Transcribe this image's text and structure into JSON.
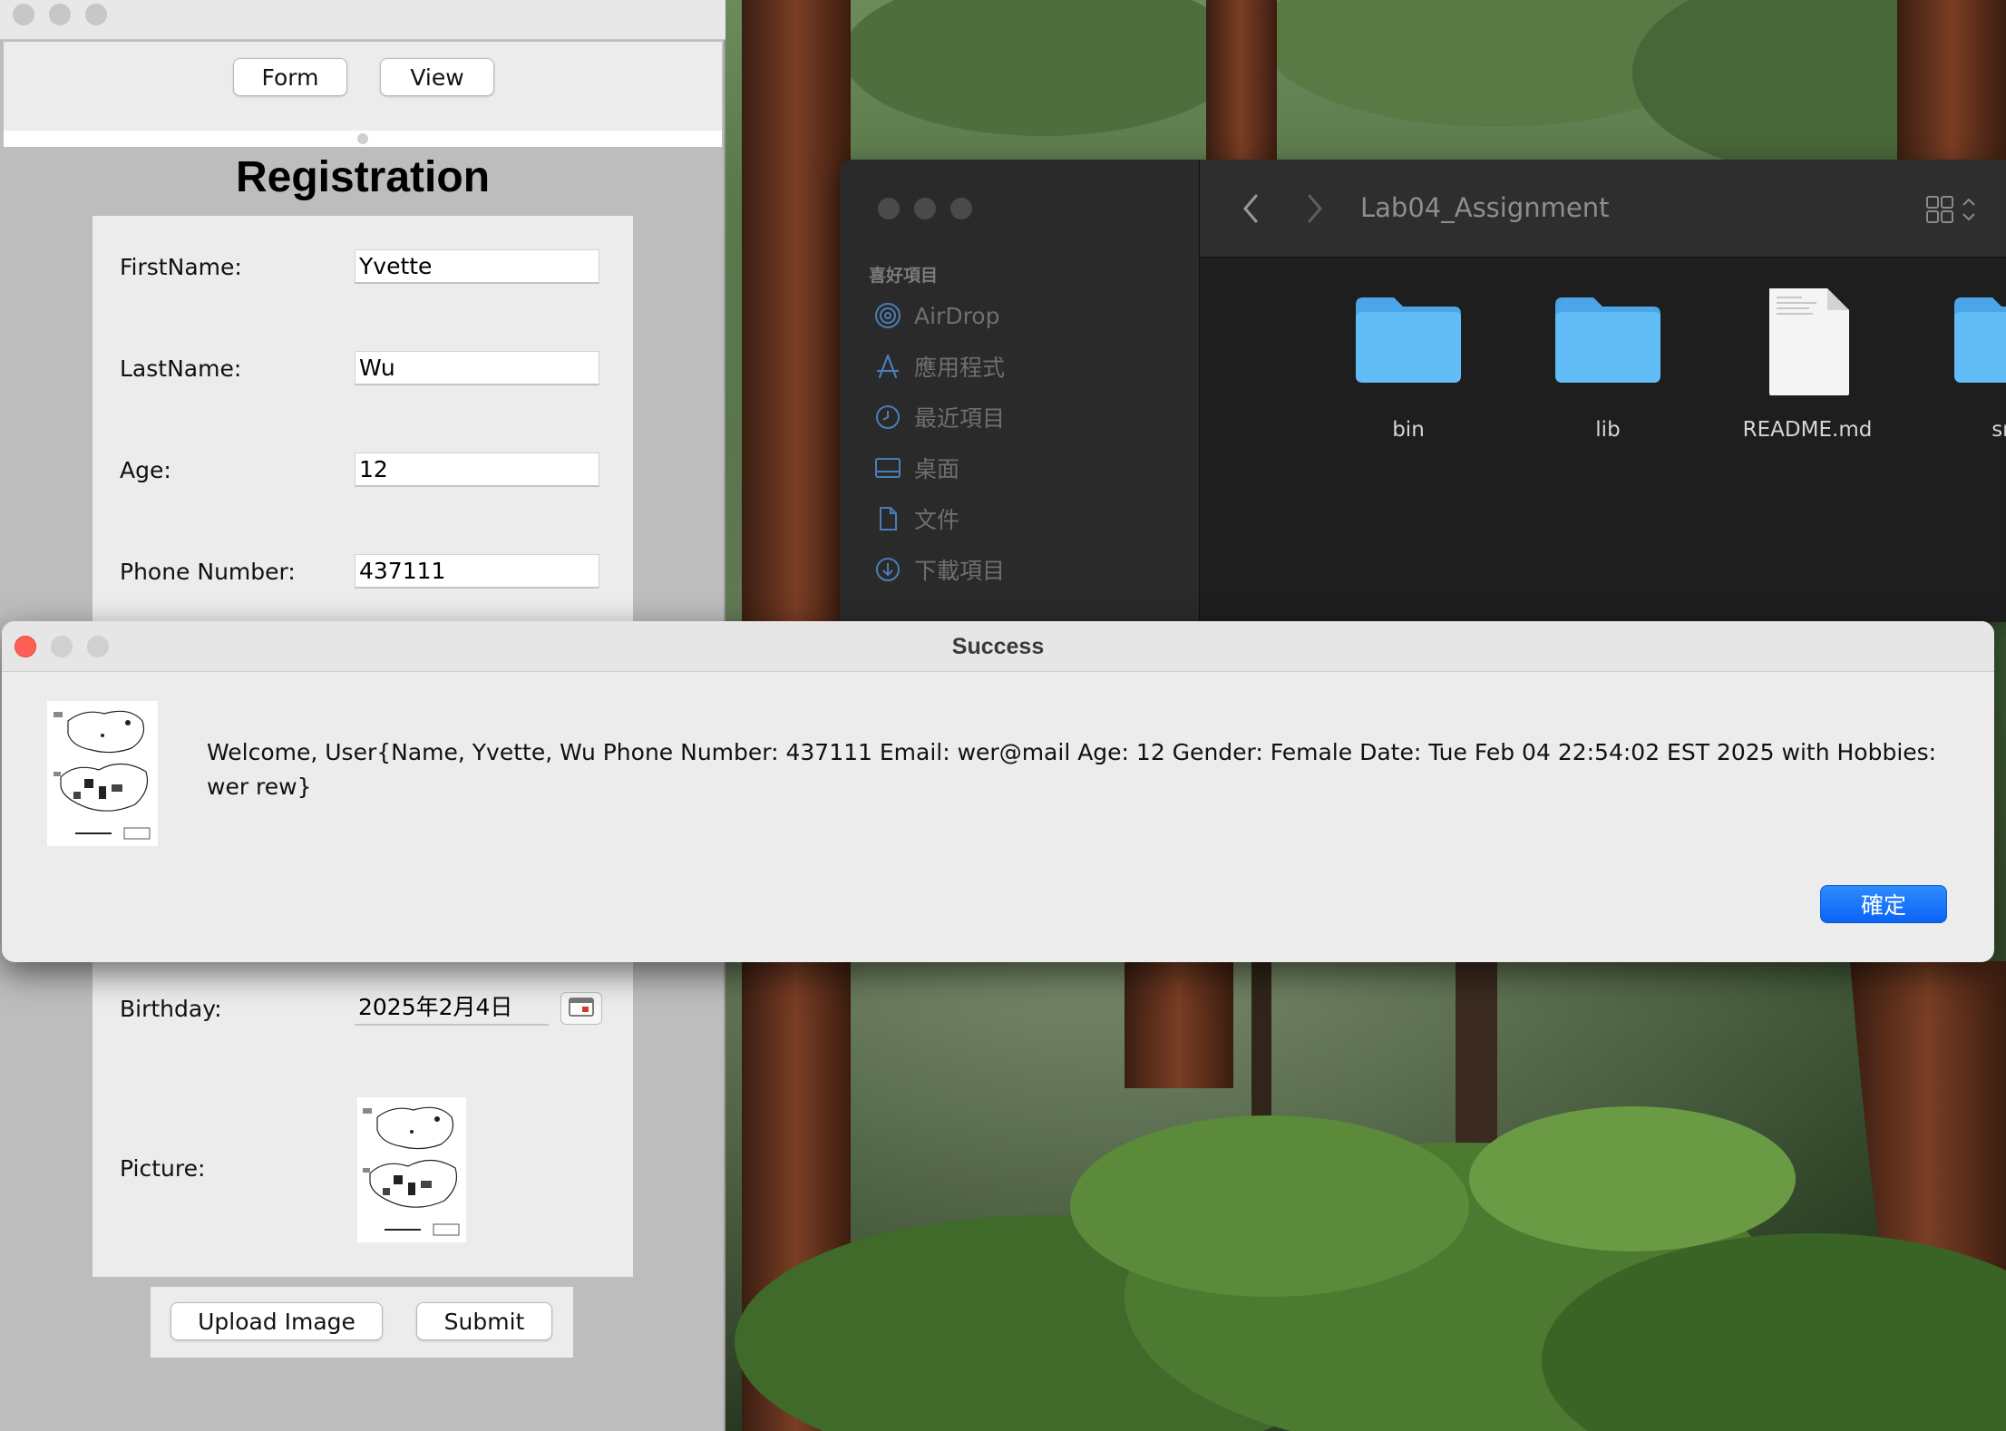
{
  "registration": {
    "toolbar": {
      "form_label": "Form",
      "view_label": "View"
    },
    "title": "Registration",
    "fields": {
      "first_name": {
        "label": "FirstName:",
        "value": "Yvette"
      },
      "last_name": {
        "label": "LastName:",
        "value": "Wu"
      },
      "age": {
        "label": "Age:",
        "value": "12"
      },
      "phone": {
        "label": "Phone Number:",
        "value": "437111"
      },
      "birthday": {
        "label": "Birthday:",
        "value": "2025年2月4日"
      },
      "picture": {
        "label": "Picture:"
      }
    },
    "buttons": {
      "upload_label": "Upload Image",
      "submit_label": "Submit"
    }
  },
  "finder": {
    "title": "Lab04_Assignment",
    "sidebar_section": "喜好項目",
    "sidebar_items": [
      {
        "label": "AirDrop",
        "icon": "airdrop-icon"
      },
      {
        "label": "應用程式",
        "icon": "applications-icon"
      },
      {
        "label": "最近項目",
        "icon": "recents-icon"
      },
      {
        "label": "桌面",
        "icon": "desktop-icon"
      },
      {
        "label": "文件",
        "icon": "document-icon"
      },
      {
        "label": "下載項目",
        "icon": "downloads-icon"
      }
    ],
    "items": [
      {
        "name": "bin",
        "type": "folder"
      },
      {
        "name": "lib",
        "type": "folder"
      },
      {
        "name": "README.md",
        "type": "file"
      },
      {
        "name": "src",
        "type": "folder"
      }
    ]
  },
  "dialog": {
    "title": "Success",
    "message": "Welcome, User{Name, Yvette, Wu Phone Number: 437111 Email: wer@mail Age: 12 Gender: Female Date: Tue Feb 04 22:54:02 EST 2025 with Hobbies: wer rew}",
    "ok_label": "確定"
  },
  "colors": {
    "close_red": "#ff5f57",
    "inactive_light": "#c7c7c7",
    "accent_blue": "#0a64f5",
    "folder_blue": "#5ab4f0"
  }
}
